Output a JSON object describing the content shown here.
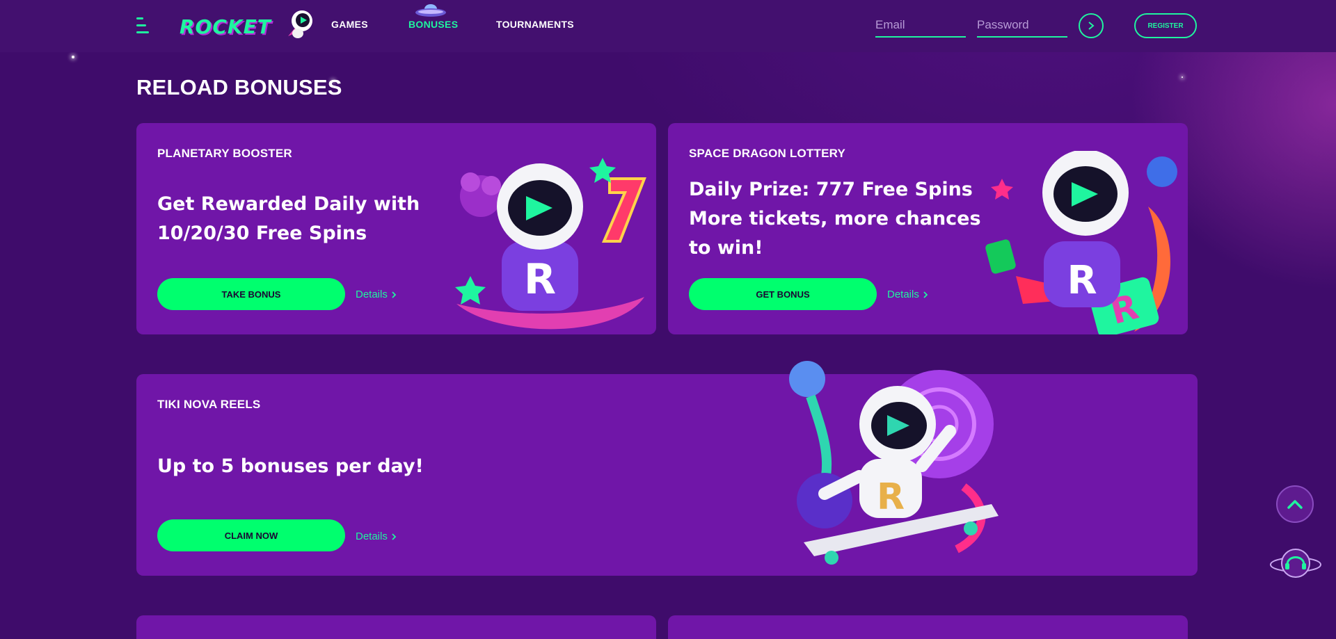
{
  "header": {
    "menu_icon": "hamburger-menu-icon",
    "logo_text": "ROCKET",
    "nav": [
      {
        "label": "GAMES"
      },
      {
        "label": "BONUSES",
        "active": true
      },
      {
        "label": "TOURNAMENTS"
      }
    ],
    "email_placeholder": "Email",
    "password_placeholder": "Password",
    "login_icon": "chevron-right-icon",
    "register_label": "REGISTER"
  },
  "page_title": "RELOAD BONUSES",
  "cards": [
    {
      "label": "PLANETARY BOOSTER",
      "headline": "Get Rewarded Daily with 10/20/30 Free Spins",
      "cta": "TAKE BONUS",
      "details": "Details"
    },
    {
      "label": "SPACE DRAGON LOTTERY",
      "headline": "Daily Prize: 777 Free Spins More tickets, more chances to win!",
      "cta": "GET BONUS",
      "details": "Details"
    },
    {
      "label": "TIKI NOVA REELS",
      "headline": "Up to 5 bonuses per day!",
      "cta": "CLAIM NOW",
      "details": "Details"
    }
  ],
  "floating": {
    "scroll_top_icon": "chevron-up-icon",
    "support_icon": "headset-support-icon"
  },
  "colors": {
    "background": "#3f0c6b",
    "card": "#7016a8",
    "accent": "#1ff59f",
    "cta": "#00ff6e"
  }
}
